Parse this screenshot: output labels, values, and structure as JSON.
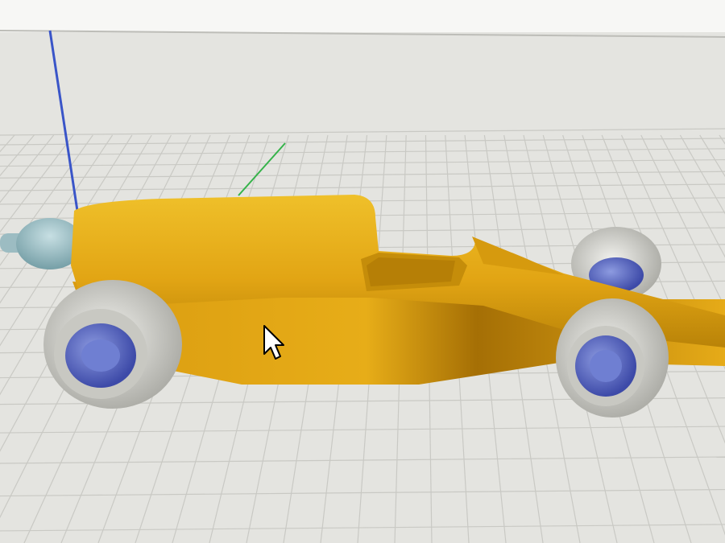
{
  "viewport": {
    "name": "3d-perspective-viewport",
    "background_color": "#e4e4e0",
    "grid_color": "#c9c9c4",
    "top_bar_color": "#f7f7f5"
  },
  "axes": {
    "z_axis_color": "#3a55c8",
    "y_axis_color": "#35b34a"
  },
  "model": {
    "name": "race-car-model",
    "body_color": "#e2a514",
    "body_shadow_color": "#b47e08",
    "tire_color": "#d9d9d3",
    "hub_color": "#5868c4",
    "nose_cone_color": "#8fb6bd"
  },
  "cursor": {
    "icon": "arrow-pointer-icon"
  }
}
